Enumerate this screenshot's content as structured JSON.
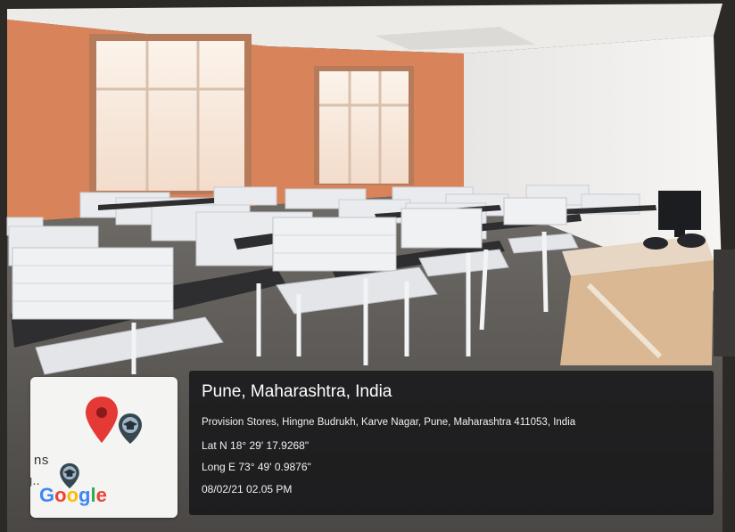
{
  "overlay": {
    "city": "Pune, Maharashtra, India",
    "address": "Provision Stores, Hingne Budrukh, Karve Nagar, Pune, Maharashtra 411053, India",
    "latitude": "Lat N 18° 29' 17.9268\"",
    "longitude": "Long E 73° 49' 0.9876\"",
    "timestamp": "08/02/21 02.05 PM"
  },
  "map_card": {
    "fragment_1": "ns",
    "fragment_2": "g..",
    "logo_letters": [
      "G",
      "o",
      "o",
      "g",
      "l",
      "e"
    ],
    "pin_color": "#E53935",
    "marker_color": "#37474F"
  },
  "icons": [
    "map-pin-icon",
    "education-marker-icon"
  ]
}
